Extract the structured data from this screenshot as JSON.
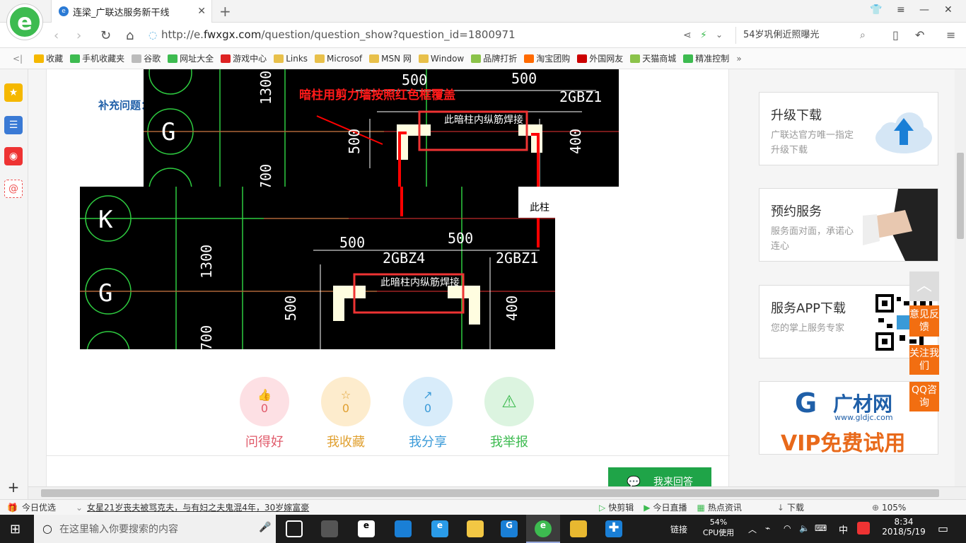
{
  "tab": {
    "title": "连梁_广联达服务新干线"
  },
  "address": {
    "url_prefix": "http://e.",
    "url_domain": "fwxgx.com",
    "url_rest": "/question/question_show?question_id=1800971",
    "search_text": "54岁巩俐近照曝光"
  },
  "bookmarks": [
    {
      "label": "收藏",
      "color": "#f5b800"
    },
    {
      "label": "手机收藏夹",
      "color": "#3dbb50"
    },
    {
      "label": "谷歌",
      "color": "#bbbbbb"
    },
    {
      "label": "网址大全",
      "color": "#3dbb50"
    },
    {
      "label": "游戏中心",
      "color": "#d22"
    },
    {
      "label": "Links",
      "color": "#e8c04a"
    },
    {
      "label": "Microsof",
      "color": "#e8c04a"
    },
    {
      "label": "MSN 网",
      "color": "#e8c04a"
    },
    {
      "label": "Window",
      "color": "#e8c04a"
    },
    {
      "label": "品牌打折",
      "color": "#8bc34a"
    },
    {
      "label": "淘宝团购",
      "color": "#ff6a00"
    },
    {
      "label": "外国网友",
      "color": "#c00"
    },
    {
      "label": "天猫商城",
      "color": "#8bc34a"
    },
    {
      "label": "精准控制",
      "color": "#3dbb50"
    }
  ],
  "main": {
    "supplement_label": "补充问题：",
    "cad_annotation": "暗柱用剪力墙按照红色框覆盖",
    "cad_top": {
      "dims": [
        "500",
        "500",
        "1300",
        "500",
        "700",
        "400"
      ],
      "axis": "G",
      "labels": [
        "2GBZ1",
        "此暗柱内纵筋焊接"
      ]
    },
    "cad_bottom": {
      "axes": [
        "K",
        "G"
      ],
      "dims": [
        "500",
        "500",
        "1300",
        "500",
        "700",
        "400"
      ],
      "labels": [
        "2GBZ4",
        "2GBZ1",
        "此暗柱内纵筋焊接",
        "此柱"
      ]
    },
    "actions": [
      {
        "label": "问得好",
        "count": "0",
        "color": "#e05a6a",
        "bg": "#fde0e4",
        "icon": "thumb-up-icon",
        "glyph": "👍"
      },
      {
        "label": "我收藏",
        "count": "0",
        "color": "#e0a030",
        "bg": "#fdeccd",
        "icon": "star-icon",
        "glyph": "☆"
      },
      {
        "label": "我分享",
        "count": "0",
        "color": "#3a9ad8",
        "bg": "#d8ecfa",
        "icon": "share-icon",
        "glyph": "↗"
      },
      {
        "label": "我举报",
        "count": "",
        "color": "#3dbb50",
        "bg": "#dcf4e0",
        "icon": "warning-icon",
        "glyph": "⚠"
      }
    ],
    "answer_button": "我来回答"
  },
  "right": {
    "upgrade": {
      "title": "升级下载",
      "desc": "广联达官方唯一指定升级下载"
    },
    "booking": {
      "title": "预约服务",
      "desc": "服务面对面，承诺心连心"
    },
    "app": {
      "title": "服务APP下载",
      "desc": "您的掌上服务专家"
    },
    "ad": {
      "brand": "广材网",
      "site": "www.gldjc.com",
      "slogan": "VIP免费试用"
    }
  },
  "float": {
    "feedback": "意见反馈",
    "follow": "关注我们",
    "qq": "QQ咨询"
  },
  "statusbar": {
    "today": "今日优选",
    "news": "女星21岁丧夫被骂克夫，与有妇之夫鬼混4年，30岁嫁富豪",
    "items": [
      "快剪辑",
      "今日直播",
      "热点资讯",
      "下载"
    ],
    "zoom": "105%"
  },
  "taskbar": {
    "search_placeholder": "在这里输入你要搜索的内容",
    "link_label": "链接",
    "cpu_percent": "54%",
    "cpu_label": "CPU使用",
    "ime": "中",
    "time": "8:34",
    "date": "2018/5/19"
  }
}
